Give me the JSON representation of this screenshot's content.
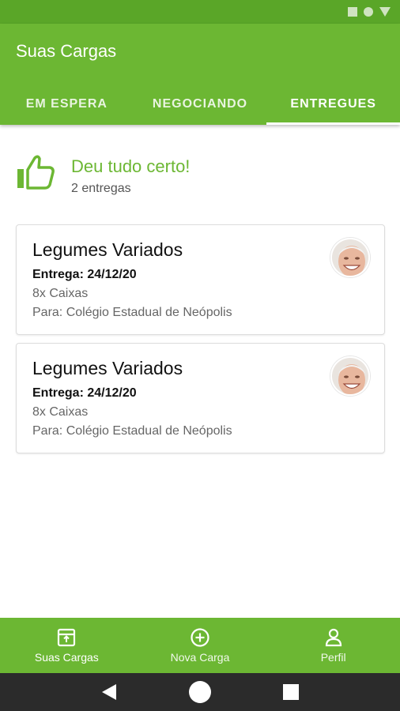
{
  "app": {
    "title": "Suas Cargas"
  },
  "tabs": [
    {
      "label": "EM ESPERA"
    },
    {
      "label": "NEGOCIANDO"
    },
    {
      "label": "ENTREGUES"
    }
  ],
  "banner": {
    "title": "Deu tudo certo!",
    "subtitle": "2 entregas",
    "icon": "thumbs-up-icon"
  },
  "cards": [
    {
      "title": "Legumes Variados",
      "date": "Entrega: 24/12/20",
      "quantity": "8x Caixas",
      "destination": "Para: Colégio Estadual de Neópolis"
    },
    {
      "title": "Legumes Variados",
      "date": "Entrega: 24/12/20",
      "quantity": "8x Caixas",
      "destination": "Para: Colégio Estadual de Neópolis"
    }
  ],
  "bottom_nav": [
    {
      "label": "Suas Cargas",
      "icon": "box-icon"
    },
    {
      "label": "Nova Carga",
      "icon": "add-circle-icon"
    },
    {
      "label": "Perfil",
      "icon": "person-icon"
    }
  ],
  "colors": {
    "primary": "#6cb733",
    "status_bar": "#5aa628",
    "system_nav": "#2b2b2b"
  }
}
